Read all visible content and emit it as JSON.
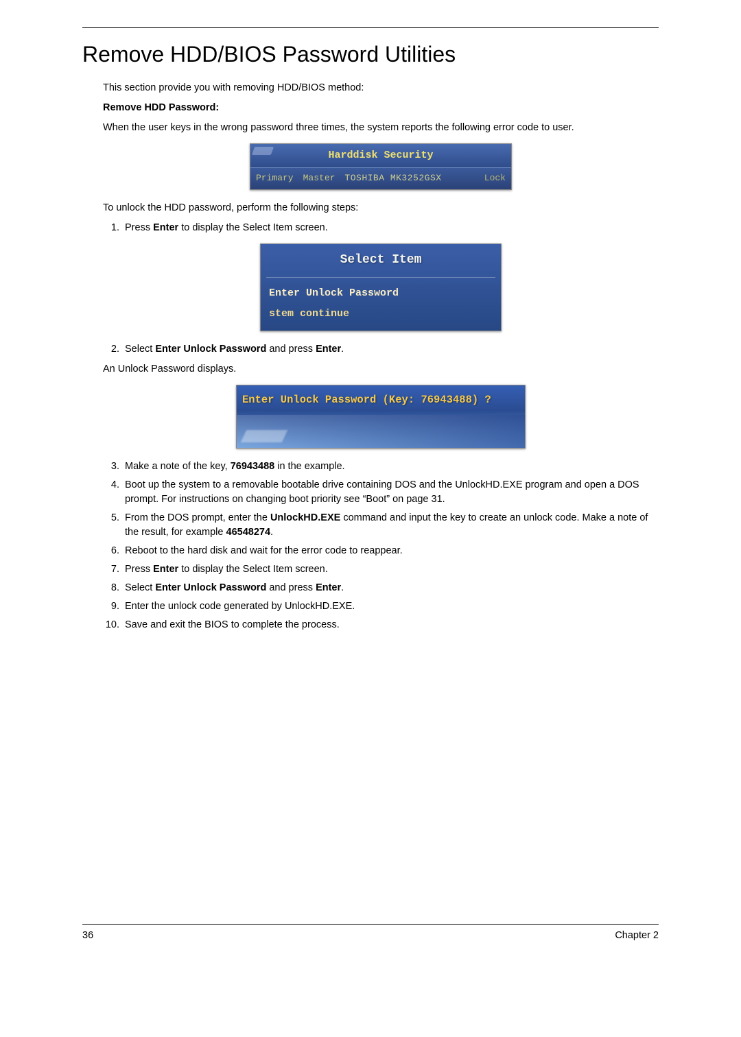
{
  "title": "Remove HDD/BIOS Password Utilities",
  "intro": "This section provide you with removing HDD/BIOS method:",
  "subhead": "Remove HDD Password:",
  "lead": "When the user keys in the wrong password three times, the system reports the following error code to user.",
  "fig1": {
    "header": "Harddisk  Security",
    "primary": "Primary",
    "master": "Master",
    "device": "TOSHIBA MK3252GSX",
    "state": "Lock"
  },
  "unlock_intro": "To unlock the HDD password, perform the following steps:",
  "step1_pre": "Press ",
  "step1_bold": "Enter",
  "step1_post": " to display the Select Item screen.",
  "fig2": {
    "title": "Select Item",
    "opt1": "Enter Unlock Password",
    "opt2": "stem continue"
  },
  "step2_pre": "Select ",
  "step2_b1": "Enter Unlock Password",
  "step2_mid": " and press ",
  "step2_b2": "Enter",
  "step2_post": ".",
  "after2": "An Unlock Password displays.",
  "fig3": {
    "prompt_pre": "Enter Unlock  Password (Key: ",
    "key": "76943488",
    "prompt_post": ") ?"
  },
  "step3_pre": "Make a note of the key, ",
  "step3_bold": "76943488",
  "step3_post": " in the example.",
  "step4": "Boot up the system to a removable bootable drive containing DOS and the UnlockHD.EXE program and open a DOS prompt. For instructions on changing boot priority see “Boot” on page 31.",
  "step5_pre": "From the DOS prompt, enter the ",
  "step5_b1": "UnlockHD.EXE",
  "step5_mid": " command and input the key to create an unlock code. Make a note of the result, for example ",
  "step5_b2": "46548274",
  "step5_post": ".",
  "step6": "Reboot to the hard disk and wait for the error code to reappear.",
  "step7_pre": "Press ",
  "step7_bold": "Enter",
  "step7_post": " to display the Select Item screen.",
  "step8_pre": "Select ",
  "step8_b1": "Enter Unlock Password",
  "step8_mid": " and press ",
  "step8_b2": "Enter",
  "step8_post": ".",
  "step9": "Enter the unlock code generated by UnlockHD.EXE.",
  "step10": "Save and exit the BIOS to complete the process.",
  "footer": {
    "page": "36",
    "chapter": "Chapter 2"
  }
}
